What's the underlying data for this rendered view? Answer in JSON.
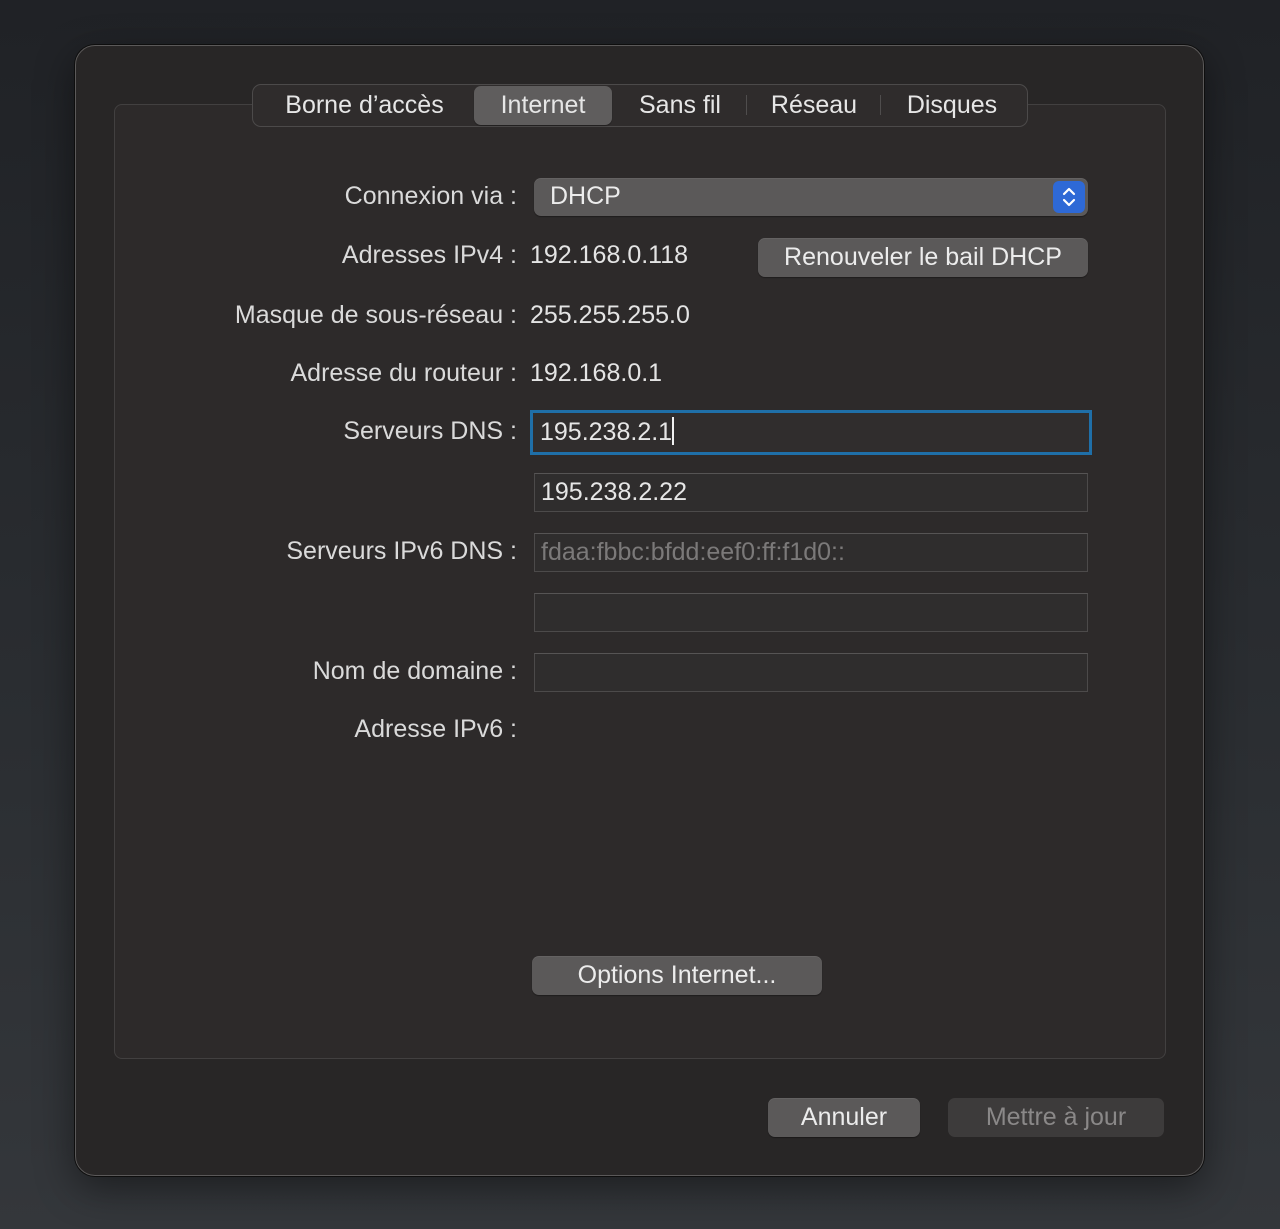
{
  "tabs": [
    {
      "label": "Borne d’accès",
      "selected": false
    },
    {
      "label": "Internet",
      "selected": true
    },
    {
      "label": "Sans fil",
      "selected": false
    },
    {
      "label": "Réseau",
      "selected": false
    },
    {
      "label": "Disques",
      "selected": false
    }
  ],
  "form": {
    "connection": {
      "label": "Connexion via :",
      "value": "DHCP"
    },
    "ipv4": {
      "label": "Adresses IPv4 :",
      "value": "192.168.0.118"
    },
    "renew_button": "Renouveler le bail DHCP",
    "subnet": {
      "label": "Masque de sous-réseau :",
      "value": "255.255.255.0"
    },
    "router": {
      "label": "Adresse du routeur :",
      "value": "192.168.0.1"
    },
    "dns": {
      "label": "Serveurs DNS :",
      "primary": "195.238.2.1",
      "secondary": "195.238.2.22"
    },
    "ipv6_dns": {
      "label": "Serveurs IPv6 DNS :",
      "primary_placeholder": "fdaa:fbbc:bfdd:eef0:ff:f1d0::",
      "secondary": ""
    },
    "domain": {
      "label": "Nom de domaine :",
      "value": ""
    },
    "ipv6": {
      "label": "Adresse IPv6 :",
      "value": ""
    },
    "options_button": "Options Internet..."
  },
  "footer": {
    "cancel_button": "Annuler",
    "update_button": "Mettre à jour",
    "update_enabled": false
  },
  "colors": {
    "focus_ring": "#1f6fa8",
    "popup_accent": "#2e69d6"
  },
  "icons": {
    "popup": "chevron-up-down-icon"
  }
}
